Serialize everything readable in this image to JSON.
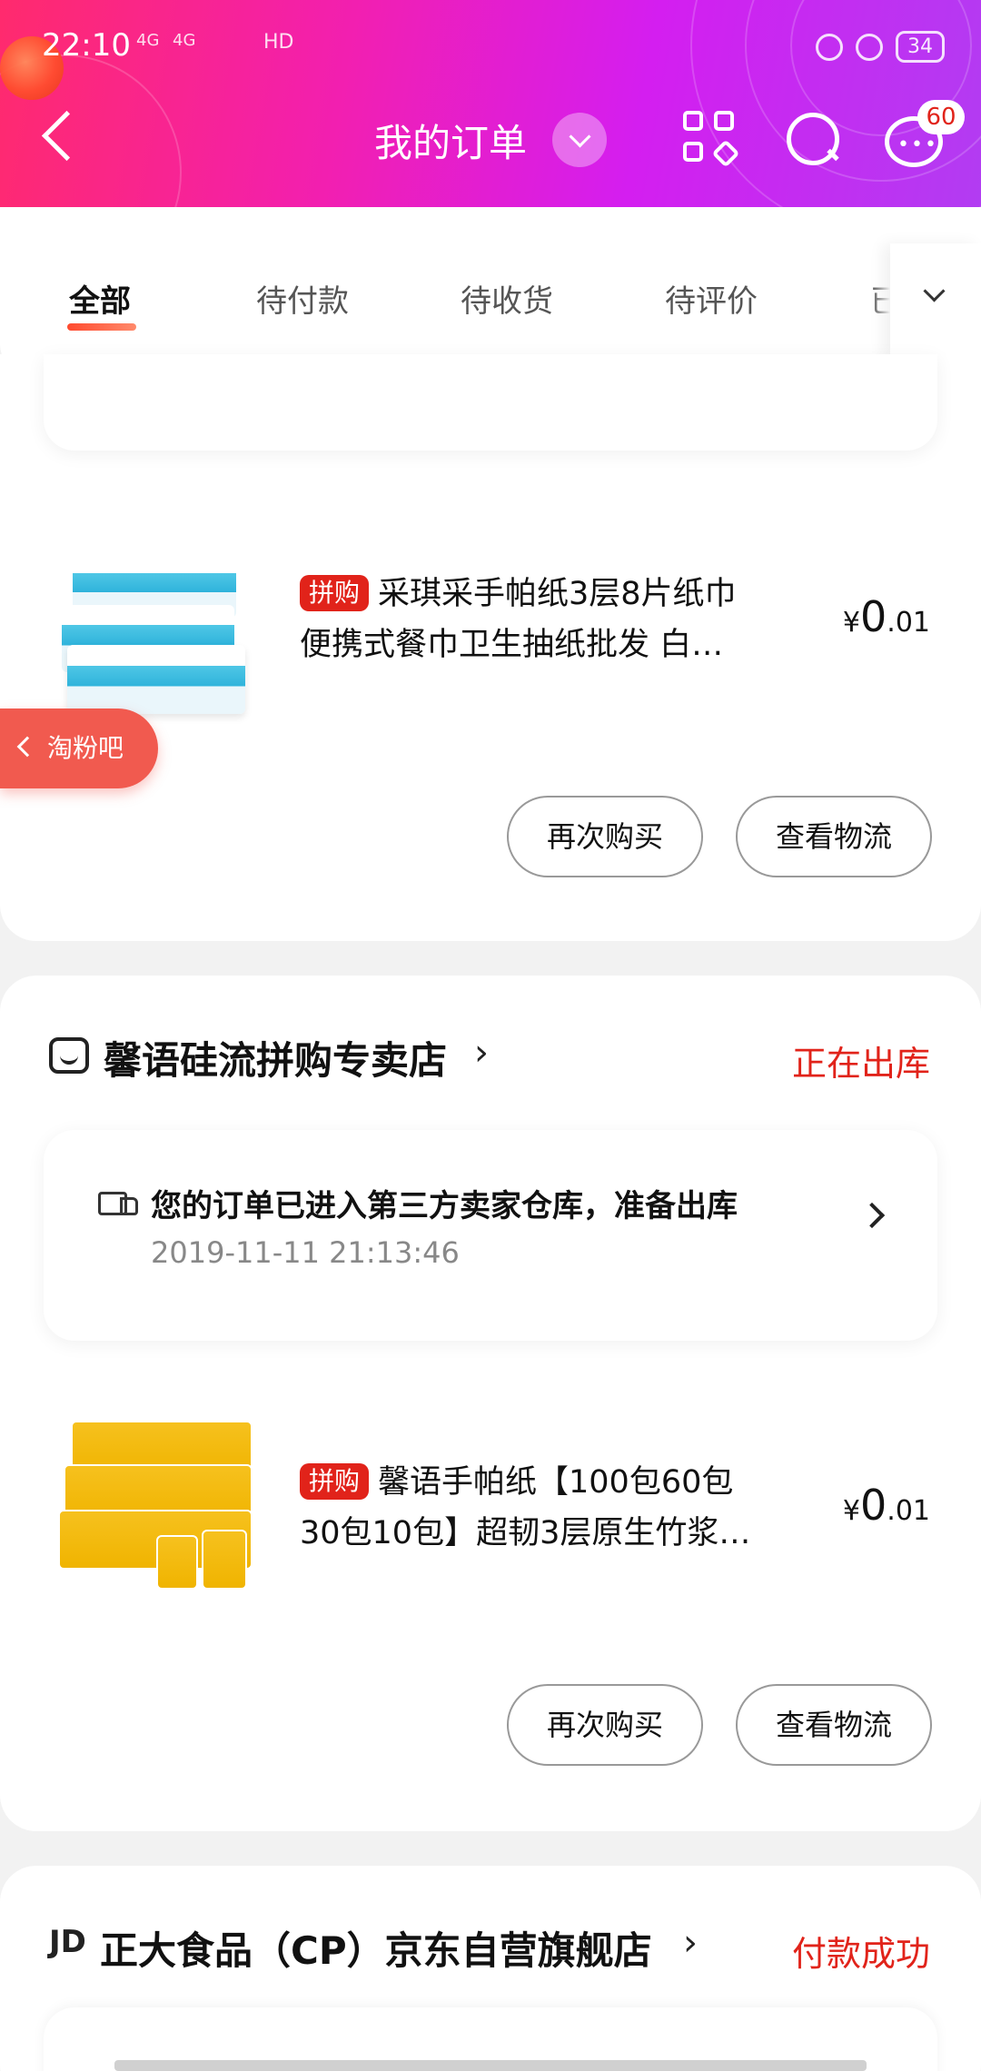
{
  "status_bar": {
    "time": "22:10",
    "signal1": "4G",
    "signal2": "4G",
    "network": "HD",
    "battery": "34"
  },
  "nav": {
    "title": "我的订单",
    "badge": "60"
  },
  "tabs": [
    {
      "label": "全部",
      "active": true
    },
    {
      "label": "待付款"
    },
    {
      "label": "待收货"
    },
    {
      "label": "待评价"
    },
    {
      "label": "已"
    }
  ],
  "float_button": {
    "label": "淘粉吧"
  },
  "orders": [
    {
      "product": {
        "badge": "拼购",
        "title_line1": "采琪采手帕纸3层8片纸巾",
        "title_line2": "便携式餐巾卫生抽纸批发 白…",
        "price_symbol": "¥",
        "price_int": "0",
        "price_dec": ".01"
      },
      "buttons": {
        "rebuy": "再次购买",
        "logistics": "查看物流"
      }
    },
    {
      "store_name": "馨语硅流拼购专卖店",
      "store_arrow": "›",
      "status": "正在出库",
      "logistics": {
        "message": "您的订单已进入第三方卖家仓库，准备出库",
        "time": "2019-11-11 21:13:46"
      },
      "product": {
        "badge": "拼购",
        "title_line1": "馨语手帕纸【100包60包",
        "title_line2": "30包10包】超韧3层原生竹浆…",
        "price_symbol": "¥",
        "price_int": "0",
        "price_dec": ".01"
      },
      "buttons": {
        "rebuy": "再次购买",
        "logistics": "查看物流"
      }
    },
    {
      "store_logo": "JD",
      "store_name": "正大食品（CP）京东自营旗舰店",
      "store_arrow": "›",
      "status": "付款成功"
    }
  ]
}
